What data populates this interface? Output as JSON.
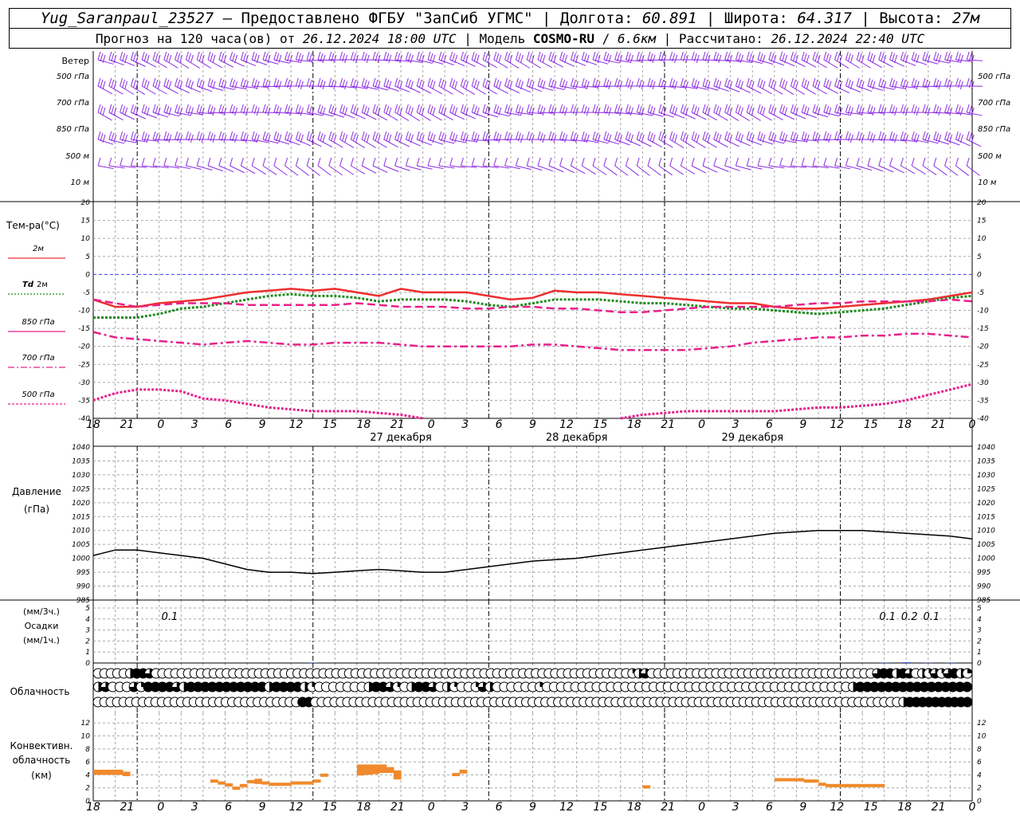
{
  "header": {
    "station": "Yug_Saranpaul_23527",
    "provider": " – Предоставлено ФГБУ \"ЗапСиб УГМС\" | ",
    "lon_label": "Долгота: ",
    "lon": "60.891",
    "lat_label": " | Широта: ",
    "lat": "64.317",
    "alt_label": " | Высота: ",
    "alt": "27м",
    "forecast_label": "Прогноз на 120 часа(ов) от ",
    "start": "26.12.2024 18:00 UTC",
    "model_label": "  | Модель ",
    "model": "COSMO-RU",
    "res_sep": " / ",
    "res": "6.6км",
    "calc_label": " | Рассчитано: ",
    "calc": "26.12.2024 22:40 UTC"
  },
  "colors": {
    "wind": "#8b2be2",
    "t2m": "#ee2e2e",
    "td": "#228b22",
    "t850": "#e8208a",
    "t700": "#e8208a",
    "t500": "#e8208a",
    "zero_line": "#3b3bff",
    "precip": "#1f3fe0",
    "conv": "#f08a2c",
    "grid": "#a8a8a8"
  },
  "time_axis": {
    "ticks": [
      "18",
      "21",
      "0",
      "3",
      "6",
      "9",
      "12",
      "15",
      "18",
      "21",
      "0",
      "3",
      "6",
      "9",
      "12",
      "15",
      "18",
      "21",
      "0",
      "3",
      "6",
      "9",
      "12",
      "15",
      "18",
      "21",
      "0"
    ],
    "days": [
      "27 декабря",
      "28 декабря",
      "29 декабря"
    ]
  },
  "wind_panel": {
    "title": "Ветер",
    "levels": [
      "500 гПа",
      "700 гПа",
      "850 гПа",
      "500 м",
      "10  м"
    ]
  },
  "temp_panel": {
    "title": "Тем-ра(°С)",
    "y_ticks": [
      "20",
      "15",
      "10",
      "5",
      "0",
      "-5",
      "-10",
      "-15",
      "-20",
      "-25",
      "-30",
      "-35",
      "-40"
    ],
    "legend": [
      {
        "key": "t2m",
        "label": "2м"
      },
      {
        "key": "td",
        "label_a": "Td",
        "label_b": " 2м"
      },
      {
        "key": "t850",
        "label": "850 гПа"
      },
      {
        "key": "t700",
        "label": "700 гПа"
      },
      {
        "key": "t500",
        "label": "500 гПа"
      }
    ]
  },
  "pressure_panel": {
    "title_1": "Давление",
    "title_2": "(гПа)",
    "y_ticks": [
      "1040",
      "1035",
      "1030",
      "1025",
      "1020",
      "1015",
      "1010",
      "1005",
      "1000",
      "995",
      "990",
      "985"
    ]
  },
  "precip_panel": {
    "title_1": "(мм/3ч.)",
    "title_2": "Осадки",
    "title_3": "(мм/1ч.)",
    "y_ticks": [
      "5",
      "4",
      "3",
      "2",
      "1",
      "0"
    ],
    "labels": [
      "0.1",
      "0.1",
      "0.2",
      "0.1"
    ]
  },
  "cloud_panel": {
    "title": "Облачность"
  },
  "conv_panel": {
    "title_1": "Конвективн.",
    "title_2": "облачность",
    "title_3": "(км)",
    "y_ticks": [
      "12",
      "10",
      "8",
      "6",
      "4",
      "2",
      "0"
    ]
  },
  "chart_data": {
    "type": "line",
    "x": [
      0,
      3,
      6,
      9,
      12,
      15,
      18,
      21,
      24,
      27,
      30,
      33,
      36,
      39,
      42,
      45,
      48,
      51,
      54,
      57,
      60,
      63,
      66,
      69,
      72,
      75,
      78,
      81,
      84,
      87,
      90,
      93,
      96,
      99,
      102,
      105,
      108,
      111,
      114,
      117,
      120
    ],
    "x_unit": "hours from 26.12.2024 18:00 UTC",
    "series": [
      {
        "key": "t2m",
        "name": "2м",
        "values": [
          -7,
          -9,
          -9,
          -8,
          -7.5,
          -7,
          -6,
          -5,
          -4.5,
          -4,
          -4.5,
          -4,
          -5,
          -6,
          -4,
          -5,
          -5,
          -5,
          -6,
          -7,
          -6.5,
          -4.5,
          -5,
          -5,
          -5.5,
          -6,
          -6.5,
          -7,
          -7.5,
          -8,
          -8,
          -9,
          -9.5,
          -9.5,
          -9,
          -8.5,
          -8,
          -7.5,
          -7,
          -6,
          -5
        ]
      },
      {
        "key": "td",
        "name": "Td 2м",
        "values": [
          -12,
          -12,
          -12,
          -11,
          -9.5,
          -9,
          -8,
          -7,
          -6,
          -5.5,
          -6,
          -6,
          -6.5,
          -7.5,
          -7,
          -7,
          -7,
          -7.5,
          -8.5,
          -9,
          -8,
          -7,
          -7,
          -7,
          -7.5,
          -8,
          -8,
          -8.5,
          -9,
          -9.5,
          -9.5,
          -10,
          -10.5,
          -11,
          -10.5,
          -10,
          -9.5,
          -8.5,
          -7.5,
          -6.5,
          -6
        ]
      },
      {
        "key": "t850",
        "name": "850 гПа",
        "values": [
          -7,
          -8,
          -9,
          -8.5,
          -8,
          -8,
          -8,
          -8.5,
          -8.5,
          -8.5,
          -8.5,
          -8.5,
          -8,
          -8.5,
          -9,
          -9,
          -9,
          -9.5,
          -9.5,
          -9,
          -9,
          -9.5,
          -9.5,
          -10,
          -10.5,
          -10.5,
          -10,
          -9.5,
          -9,
          -9,
          -9,
          -9,
          -8.5,
          -8,
          -8,
          -7.5,
          -7.5,
          -7.5,
          -7.5,
          -7,
          -7.5
        ]
      },
      {
        "key": "t700",
        "name": "700 гПа",
        "values": [
          -16,
          -17.5,
          -18,
          -18.5,
          -19,
          -19.5,
          -19,
          -18.5,
          -19,
          -19.5,
          -19.5,
          -19,
          -19,
          -19,
          -19.5,
          -20,
          -20,
          -20,
          -20,
          -20,
          -19.5,
          -19.5,
          -20,
          -20.5,
          -21,
          -21,
          -21,
          -21,
          -20.5,
          -20,
          -19,
          -18.5,
          -18,
          -17.5,
          -17.5,
          -17,
          -17,
          -16.5,
          -16.5,
          -17,
          -17.5
        ]
      },
      {
        "key": "t500",
        "name": "500 гПа",
        "values": [
          -35,
          -33,
          -32,
          -32,
          -32.5,
          -34.5,
          -35,
          -36,
          -37,
          -37.5,
          -38,
          -38,
          -38,
          -38.5,
          -39,
          -40,
          null,
          null,
          null,
          null,
          null,
          null,
          null,
          null,
          -40,
          -39,
          -38.5,
          -38,
          -38,
          -38,
          -38,
          -38,
          -37.5,
          -37,
          -37,
          -36.5,
          -36,
          -35,
          -33.5,
          -32,
          -30.5
        ]
      },
      {
        "key": "pressure",
        "name": "Давление",
        "values": [
          1001,
          1003,
          1003,
          1002,
          1001,
          1000,
          998,
          996,
          995,
          995,
          994.5,
          995,
          995.5,
          996,
          995.5,
          995,
          995,
          996,
          997,
          998,
          999,
          999.5,
          1000,
          1001,
          1002,
          1003,
          1004,
          1005,
          1006,
          1007,
          1008,
          1009,
          1009.5,
          1010,
          1010,
          1010,
          1009.5,
          1009,
          1008.5,
          1008,
          1007
        ]
      }
    ],
    "precip_mm": [
      0,
      0,
      0,
      0,
      0,
      0,
      0,
      0,
      0,
      0,
      0.1,
      0,
      0,
      0,
      0,
      0,
      0,
      0,
      0,
      0,
      0,
      0,
      0,
      0,
      0,
      0,
      0,
      0,
      0,
      0,
      0,
      0,
      0,
      0,
      0,
      0,
      0.1,
      0.2,
      0.1,
      0.1,
      0
    ],
    "cloud_rows": {
      "high": [
        0,
        0,
        0,
        0,
        0,
        0.5,
        1,
        1,
        0.75,
        0,
        0,
        0,
        0,
        0,
        0,
        0,
        0,
        0,
        0,
        0,
        0,
        0,
        0,
        0,
        0,
        0,
        0,
        0,
        0,
        0,
        0,
        0,
        0,
        0,
        0,
        0,
        0,
        0,
        0,
        0,
        0,
        0,
        0,
        0,
        0,
        0,
        0,
        0,
        0,
        0,
        0,
        0,
        0,
        0,
        0,
        0,
        0,
        0,
        0,
        0,
        0,
        0,
        0,
        0,
        0,
        0,
        0,
        0,
        0,
        0,
        0,
        0,
        0,
        0,
        0,
        0,
        0,
        0,
        0,
        0,
        0,
        0,
        0,
        0.25,
        0.5,
        0.75,
        0,
        0,
        0,
        0,
        0,
        0,
        0,
        0,
        0,
        0,
        0,
        0,
        0,
        0,
        0,
        0,
        0,
        0,
        0,
        0,
        0,
        0,
        0,
        0,
        0,
        0,
        0,
        0,
        0,
        0,
        0,
        0,
        0,
        0,
        0,
        0.75,
        1,
        1,
        0.5,
        1,
        0.75,
        0,
        0.5,
        0.25,
        0.75,
        0.25,
        0.75,
        1,
        0.5,
        0.25
      ],
      "middle": [
        0.5,
        0.75,
        0,
        0,
        0,
        0.75,
        0.25,
        1,
        1,
        1,
        1,
        0.75,
        0.5,
        1,
        1,
        1,
        1,
        1,
        1,
        1,
        1,
        1,
        1,
        1,
        0.5,
        1,
        1,
        1,
        1,
        0.5,
        0.25,
        0,
        0,
        0,
        0,
        0,
        0,
        0,
        0.5,
        1,
        1,
        0.75,
        0.25,
        0,
        0.5,
        1,
        1,
        0.75,
        0,
        0.5,
        0.25,
        0,
        0,
        0.25,
        0.75,
        0.5,
        0,
        0,
        0,
        0,
        0,
        0,
        0.25,
        0,
        0,
        0,
        0,
        0,
        0,
        0,
        0,
        0,
        0,
        0,
        0,
        0,
        0,
        0,
        0,
        0,
        0,
        0,
        0,
        0,
        0,
        0,
        0,
        0,
        0,
        0,
        0,
        0,
        0,
        0,
        0,
        0,
        0,
        0,
        0,
        0,
        0,
        0,
        0,
        0,
        0,
        0,
        0.5,
        1,
        1,
        1,
        1,
        1,
        1,
        1,
        1,
        1,
        1,
        1,
        1,
        1,
        1,
        1,
        1
      ],
      "low": [
        0,
        0,
        0,
        0,
        0,
        0,
        0,
        0,
        0,
        0,
        0,
        0,
        0,
        0,
        0,
        0,
        0,
        0,
        0,
        0,
        0,
        0,
        0,
        0,
        0,
        0,
        0,
        0,
        0,
        0,
        0,
        0,
        1,
        1,
        0,
        0,
        0,
        0,
        0,
        0,
        0,
        0,
        0,
        0,
        0,
        0,
        0,
        0,
        0,
        0,
        0,
        0,
        0,
        0,
        0,
        0,
        0,
        0,
        0,
        0,
        0,
        0,
        0,
        0,
        0,
        0,
        0,
        0,
        0,
        0,
        0,
        0,
        0,
        0,
        0,
        0,
        0,
        0,
        0,
        0,
        0,
        0,
        0,
        0,
        0,
        0,
        0,
        0,
        0,
        0,
        0,
        0,
        0,
        0,
        0,
        0,
        0,
        0,
        0,
        0,
        0,
        0,
        0,
        0,
        0,
        0,
        0,
        0,
        0,
        0,
        0,
        0,
        0,
        0,
        0,
        0,
        0,
        0,
        0,
        0,
        0,
        0,
        0,
        0,
        0,
        0,
        0.5,
        1,
        1,
        1,
        1,
        1,
        1,
        1,
        1,
        1,
        1
      ]
    },
    "conv_km": [
      {
        "h": 0,
        "top": 4.8,
        "base": 4
      },
      {
        "h": 1,
        "top": 4.8,
        "base": 4
      },
      {
        "h": 2,
        "top": 4.8,
        "base": 4
      },
      {
        "h": 3,
        "top": 4.8,
        "base": 4
      },
      {
        "h": 4,
        "top": 4.5,
        "base": 3.8
      },
      {
        "h": 16,
        "top": 3.3,
        "base": 2.8
      },
      {
        "h": 17,
        "top": 3,
        "base": 2.5
      },
      {
        "h": 18,
        "top": 2.7,
        "base": 2.2
      },
      {
        "h": 19,
        "top": 2.2,
        "base": 1.7
      },
      {
        "h": 20,
        "top": 2.6,
        "base": 2.1
      },
      {
        "h": 21,
        "top": 3.2,
        "base": 2.7
      },
      {
        "h": 22,
        "top": 3.4,
        "base": 2.6
      },
      {
        "h": 23,
        "top": 3,
        "base": 2.5
      },
      {
        "h": 24,
        "top": 2.8,
        "base": 2.3
      },
      {
        "h": 25,
        "top": 2.8,
        "base": 2.3
      },
      {
        "h": 26,
        "top": 2.8,
        "base": 2.3
      },
      {
        "h": 27,
        "top": 3,
        "base": 2.5
      },
      {
        "h": 28,
        "top": 3,
        "base": 2.5
      },
      {
        "h": 29,
        "top": 3,
        "base": 2.5
      },
      {
        "h": 30,
        "top": 3.3,
        "base": 2.8
      },
      {
        "h": 31,
        "top": 4.2,
        "base": 3.7
      },
      {
        "h": 36,
        "top": 5.6,
        "base": 3.9
      },
      {
        "h": 37,
        "top": 5.6,
        "base": 4
      },
      {
        "h": 38,
        "top": 5.6,
        "base": 4.1
      },
      {
        "h": 39,
        "top": 5.6,
        "base": 4.3
      },
      {
        "h": 40,
        "top": 5.2,
        "base": 4.3
      },
      {
        "h": 41,
        "top": 4.7,
        "base": 3.3
      },
      {
        "h": 49,
        "top": 4.3,
        "base": 3.8
      },
      {
        "h": 50,
        "top": 4.8,
        "base": 4.2
      },
      {
        "h": 75,
        "top": 2.4,
        "base": 1.9
      },
      {
        "h": 93,
        "top": 3.5,
        "base": 3
      },
      {
        "h": 94,
        "top": 3.5,
        "base": 3
      },
      {
        "h": 95,
        "top": 3.5,
        "base": 3
      },
      {
        "h": 96,
        "top": 3.5,
        "base": 3
      },
      {
        "h": 97,
        "top": 3.3,
        "base": 2.8
      },
      {
        "h": 98,
        "top": 3.3,
        "base": 2.8
      },
      {
        "h": 99,
        "top": 2.8,
        "base": 2.3
      },
      {
        "h": 100,
        "top": 2.6,
        "base": 2.1
      },
      {
        "h": 101,
        "top": 2.6,
        "base": 2.1
      },
      {
        "h": 102,
        "top": 2.6,
        "base": 2.1
      },
      {
        "h": 103,
        "top": 2.6,
        "base": 2.1
      },
      {
        "h": 104,
        "top": 2.6,
        "base": 2.1
      },
      {
        "h": 105,
        "top": 2.6,
        "base": 2.1
      },
      {
        "h": 106,
        "top": 2.6,
        "base": 2.1
      },
      {
        "h": 107,
        "top": 2.6,
        "base": 2.1
      }
    ],
    "ylim_temp": [
      -40,
      20
    ],
    "ylim_pressure": [
      985,
      1040
    ],
    "ylim_precip": [
      0,
      5
    ],
    "ylim_conv": [
      0,
      13
    ]
  }
}
